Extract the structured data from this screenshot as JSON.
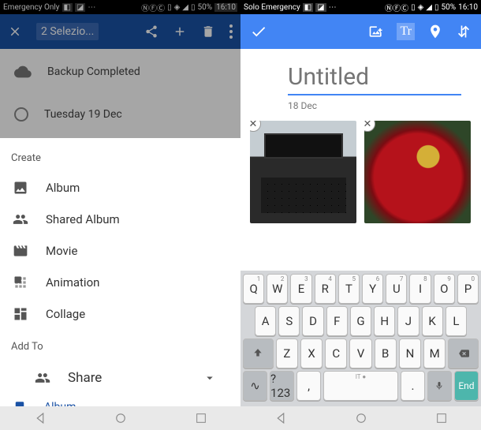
{
  "colors": {
    "primary_blue": "#1a52a5",
    "google_blue": "#4285f4",
    "enter_teal": "#4db6ac"
  },
  "status_left": {
    "carrier": "Emergency Only",
    "battery_pct": "50%",
    "time": "16:10"
  },
  "status_right": {
    "carrier": "Solo Emergency",
    "battery_pct": "50%",
    "time": "16:10"
  },
  "left": {
    "toolbar": {
      "selection": "2 Selezio..."
    },
    "backup": {
      "text": "Backup Completed"
    },
    "date_row": {
      "text": "Tuesday 19 Dec"
    },
    "sheet": {
      "header": "Create",
      "items": [
        {
          "label": "Album",
          "icon": "photo-icon"
        },
        {
          "label": "Shared Album",
          "icon": "people-icon"
        },
        {
          "label": "Movie",
          "icon": "movie-icon"
        },
        {
          "label": "Animation",
          "icon": "animation-icon"
        },
        {
          "label": "Collage",
          "icon": "collage-icon"
        }
      ],
      "add_to_header": "Add To",
      "share": {
        "label": "Share"
      },
      "album_row": {
        "label": "Album"
      }
    }
  },
  "right": {
    "toolbar": {
      "tr": "Tr"
    },
    "editor": {
      "title_placeholder": "Untitled",
      "date": "18 Dec"
    },
    "thumbs": [
      {
        "name": "photo-laptop"
      },
      {
        "name": "photo-flowers"
      }
    ],
    "keyboard": {
      "row1": [
        {
          "main": "Q",
          "sup": "1"
        },
        {
          "main": "W",
          "sup": "2"
        },
        {
          "main": "E",
          "sup": "3"
        },
        {
          "main": "R",
          "sup": "4"
        },
        {
          "main": "T",
          "sup": "5"
        },
        {
          "main": "Y",
          "sup": "6"
        },
        {
          "main": "U",
          "sup": "7"
        },
        {
          "main": "I",
          "sup": "8"
        },
        {
          "main": "O",
          "sup": "9"
        },
        {
          "main": "P",
          "sup": "0"
        }
      ],
      "row2": [
        {
          "main": "A"
        },
        {
          "main": "S"
        },
        {
          "main": "D"
        },
        {
          "main": "F"
        },
        {
          "main": "G"
        },
        {
          "main": "H"
        },
        {
          "main": "J"
        },
        {
          "main": "K"
        },
        {
          "main": "L"
        }
      ],
      "row3": [
        {
          "main": "Z"
        },
        {
          "main": "X"
        },
        {
          "main": "C"
        },
        {
          "main": "V"
        },
        {
          "main": "B"
        },
        {
          "main": "N"
        },
        {
          "main": "M"
        }
      ],
      "row4": {
        "sym": "?123",
        "comma": ",",
        "space_hint": "IT ●",
        "period": ".",
        "end": "End"
      }
    }
  }
}
